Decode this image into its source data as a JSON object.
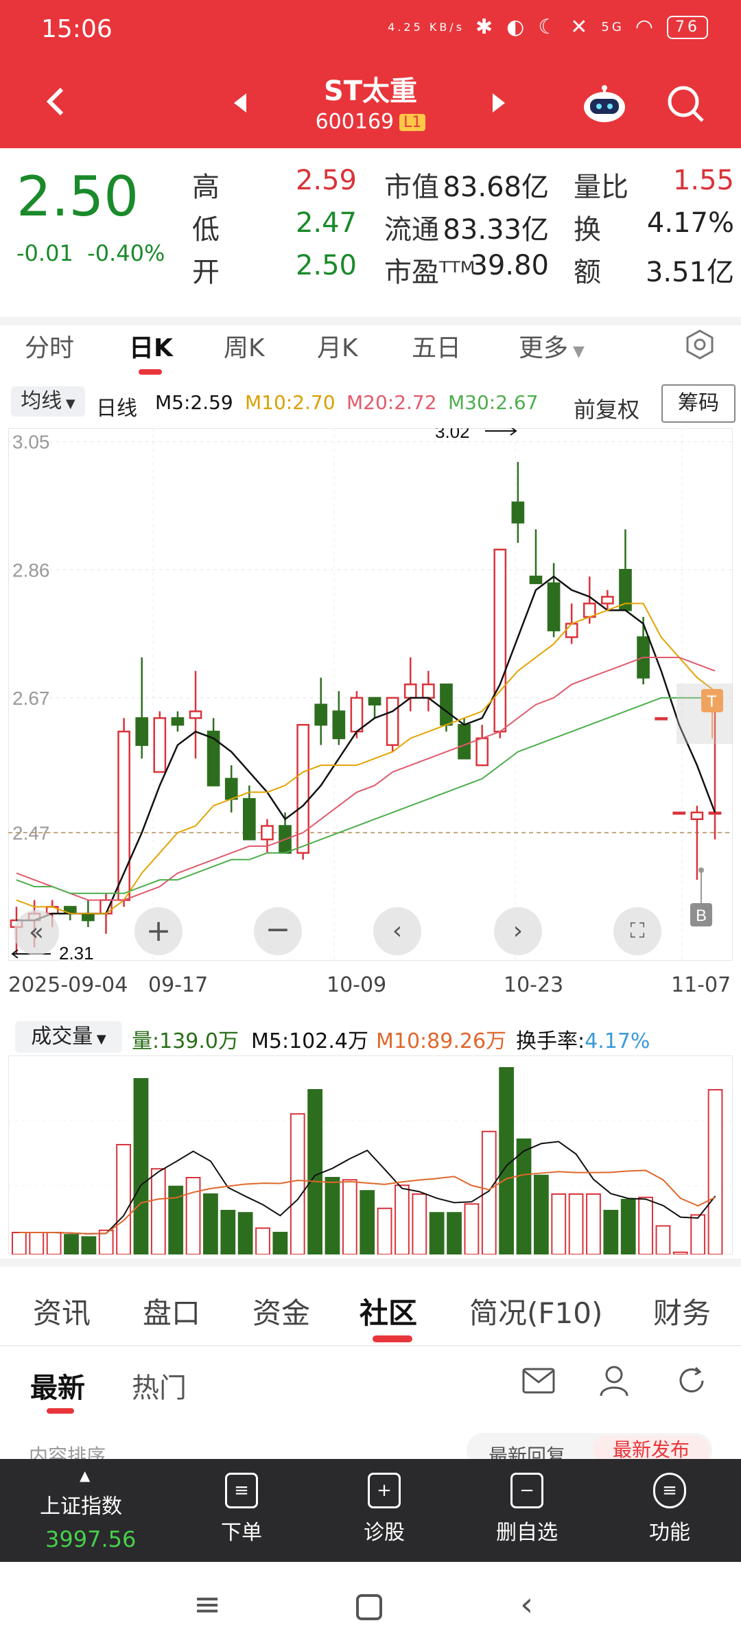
{
  "status_bar": {
    "time": "15:06",
    "net_speed": "4.25 KB/s",
    "signal": "5G",
    "battery": "76"
  },
  "header": {
    "name": "ST太重",
    "code": "600169",
    "level_badge": "L1"
  },
  "quote": {
    "price": "2.50",
    "change": "-0.01",
    "change_pct": "-0.40%",
    "high_label": "高",
    "high": "2.59",
    "low_label": "低",
    "low": "2.47",
    "open_label": "开",
    "open": "2.50",
    "mcap_label": "市值",
    "mcap": "83.68亿",
    "float_label": "流通",
    "float": "83.33亿",
    "pe_label": "市盈ᵀᵀᴹ",
    "pe": "39.80",
    "vr_label": "量比",
    "vr": "1.55",
    "turn_label": "换",
    "turn": "4.17%",
    "amt_label": "额",
    "amt": "3.51亿"
  },
  "period_tabs": [
    "分时",
    "日K",
    "周K",
    "月K",
    "五日",
    "更多"
  ],
  "indicators": {
    "ma_dropdown": "均线",
    "period": "日线",
    "ma5": "M5:2.59",
    "ma10": "M10:2.70",
    "ma20": "M20:2.72",
    "ma30": "M30:2.67",
    "adjust": "前复权",
    "chips": "筹码"
  },
  "chart_data": {
    "type": "candlestick",
    "y_ticks": [
      "3.05",
      "2.86",
      "2.67",
      "2.47"
    ],
    "y_ticks_values": [
      3.05,
      2.86,
      2.67,
      2.47
    ],
    "ylim": [
      2.28,
      3.07
    ],
    "x_labels": [
      "2025-09-04",
      "09-17",
      "10-09",
      "10-23",
      "11-07"
    ],
    "annotations": {
      "high_marker": "3.02",
      "low_marker": "2.31",
      "sell_tag": "T",
      "buy_tag": "B",
      "ref_price": 2.47
    },
    "candles": [
      {
        "o": 2.33,
        "h": 2.36,
        "l": 2.29,
        "c": 2.34
      },
      {
        "o": 2.34,
        "h": 2.37,
        "l": 2.3,
        "c": 2.35
      },
      {
        "o": 2.35,
        "h": 2.37,
        "l": 2.33,
        "c": 2.36
      },
      {
        "o": 2.36,
        "h": 2.36,
        "l": 2.34,
        "c": 2.35
      },
      {
        "o": 2.35,
        "h": 2.37,
        "l": 2.33,
        "c": 2.34
      },
      {
        "o": 2.35,
        "h": 2.38,
        "l": 2.32,
        "c": 2.37
      },
      {
        "o": 2.37,
        "h": 2.64,
        "l": 2.36,
        "c": 2.62
      },
      {
        "o": 2.64,
        "h": 2.73,
        "l": 2.58,
        "c": 2.6
      },
      {
        "o": 2.56,
        "h": 2.65,
        "l": 2.56,
        "c": 2.64
      },
      {
        "o": 2.64,
        "h": 2.65,
        "l": 2.62,
        "c": 2.63
      },
      {
        "o": 2.64,
        "h": 2.71,
        "l": 2.58,
        "c": 2.65
      },
      {
        "o": 2.62,
        "h": 2.64,
        "l": 2.54,
        "c": 2.54
      },
      {
        "o": 2.55,
        "h": 2.57,
        "l": 2.5,
        "c": 2.52
      },
      {
        "o": 2.52,
        "h": 2.54,
        "l": 2.46,
        "c": 2.46
      },
      {
        "o": 2.46,
        "h": 2.49,
        "l": 2.44,
        "c": 2.48
      },
      {
        "o": 2.48,
        "h": 2.5,
        "l": 2.44,
        "c": 2.44
      },
      {
        "o": 2.44,
        "h": 2.63,
        "l": 2.43,
        "c": 2.63
      },
      {
        "o": 2.66,
        "h": 2.7,
        "l": 2.6,
        "c": 2.63
      },
      {
        "o": 2.65,
        "h": 2.68,
        "l": 2.6,
        "c": 2.61
      },
      {
        "o": 2.62,
        "h": 2.68,
        "l": 2.61,
        "c": 2.67
      },
      {
        "o": 2.67,
        "h": 2.67,
        "l": 2.64,
        "c": 2.66
      },
      {
        "o": 2.6,
        "h": 2.67,
        "l": 2.59,
        "c": 2.67
      },
      {
        "o": 2.67,
        "h": 2.73,
        "l": 2.65,
        "c": 2.69
      },
      {
        "o": 2.67,
        "h": 2.71,
        "l": 2.65,
        "c": 2.69
      },
      {
        "o": 2.69,
        "h": 2.69,
        "l": 2.62,
        "c": 2.63
      },
      {
        "o": 2.63,
        "h": 2.64,
        "l": 2.58,
        "c": 2.58
      },
      {
        "o": 2.57,
        "h": 2.63,
        "l": 2.57,
        "c": 2.61
      },
      {
        "o": 2.62,
        "h": 2.89,
        "l": 2.61,
        "c": 2.89
      },
      {
        "o": 2.96,
        "h": 3.02,
        "l": 2.9,
        "c": 2.93
      },
      {
        "o": 2.85,
        "h": 2.92,
        "l": 2.84,
        "c": 2.84
      },
      {
        "o": 2.84,
        "h": 2.87,
        "l": 2.76,
        "c": 2.77
      },
      {
        "o": 2.76,
        "h": 2.81,
        "l": 2.75,
        "c": 2.78
      },
      {
        "o": 2.79,
        "h": 2.85,
        "l": 2.78,
        "c": 2.81
      },
      {
        "o": 2.81,
        "h": 2.83,
        "l": 2.8,
        "c": 2.82
      },
      {
        "o": 2.86,
        "h": 2.92,
        "l": 2.8,
        "c": 2.8
      },
      {
        "o": 2.76,
        "h": 2.79,
        "l": 2.69,
        "c": 2.7
      },
      {
        "o": 2.64,
        "h": 2.64,
        "l": 2.64,
        "c": 2.64
      },
      {
        "o": 2.5,
        "h": 2.5,
        "l": 2.5,
        "c": 2.5
      },
      {
        "o": 2.49,
        "h": 2.51,
        "l": 2.4,
        "c": 2.5
      },
      {
        "o": 2.5,
        "h": 2.65,
        "l": 2.46,
        "c": 2.5
      }
    ],
    "series": [
      {
        "name": "M5",
        "color": "#111111",
        "values": [
          2.34,
          2.34,
          2.35,
          2.35,
          2.35,
          2.35,
          2.41,
          2.47,
          2.54,
          2.6,
          2.62,
          2.61,
          2.59,
          2.56,
          2.53,
          2.49,
          2.51,
          2.54,
          2.58,
          2.62,
          2.64,
          2.65,
          2.67,
          2.67,
          2.65,
          2.63,
          2.64,
          2.69,
          2.76,
          2.83,
          2.85,
          2.83,
          2.82,
          2.8,
          2.8,
          2.78,
          2.71,
          2.63,
          2.57,
          2.5
        ]
      },
      {
        "name": "M10",
        "color": "#e3a300",
        "values": [
          2.37,
          2.36,
          2.36,
          2.35,
          2.35,
          2.35,
          2.37,
          2.41,
          2.44,
          2.47,
          2.48,
          2.51,
          2.52,
          2.53,
          2.53,
          2.54,
          2.56,
          2.57,
          2.57,
          2.57,
          2.58,
          2.59,
          2.61,
          2.62,
          2.63,
          2.64,
          2.65,
          2.68,
          2.71,
          2.73,
          2.75,
          2.78,
          2.79,
          2.8,
          2.81,
          2.81,
          2.76,
          2.73,
          2.7,
          2.68
        ]
      },
      {
        "name": "M20",
        "color": "#e05a6b",
        "values": [
          2.41,
          2.4,
          2.39,
          2.38,
          2.37,
          2.37,
          2.37,
          2.38,
          2.39,
          2.41,
          2.42,
          2.43,
          2.44,
          2.45,
          2.45,
          2.46,
          2.47,
          2.49,
          2.51,
          2.53,
          2.54,
          2.56,
          2.57,
          2.58,
          2.59,
          2.6,
          2.61,
          2.62,
          2.64,
          2.66,
          2.67,
          2.69,
          2.7,
          2.71,
          2.72,
          2.73,
          2.73,
          2.73,
          2.72,
          2.71
        ]
      },
      {
        "name": "M30",
        "color": "#4cae4c",
        "values": [
          2.4,
          2.39,
          2.39,
          2.38,
          2.38,
          2.38,
          2.38,
          2.39,
          2.4,
          2.4,
          2.41,
          2.42,
          2.43,
          2.43,
          2.44,
          2.44,
          2.45,
          2.46,
          2.47,
          2.48,
          2.49,
          2.5,
          2.51,
          2.52,
          2.53,
          2.54,
          2.55,
          2.57,
          2.59,
          2.6,
          2.61,
          2.62,
          2.63,
          2.64,
          2.65,
          2.66,
          2.67,
          2.67,
          2.67,
          2.67
        ]
      }
    ]
  },
  "volume": {
    "dropdown": "成交量",
    "vol": "量:139.0万",
    "m5": "M5:102.4万",
    "m10": "M10:89.26万",
    "turn_label": "换手率:",
    "turn_val": "4.17%",
    "bars": [
      20,
      20,
      20,
      18,
      16,
      22,
      100,
      160,
      78,
      62,
      70,
      55,
      40,
      38,
      24,
      20,
      128,
      150,
      70,
      68,
      58,
      42,
      63,
      55,
      38,
      38,
      46,
      112,
      170,
      105,
      72,
      55,
      55,
      55,
      40,
      50,
      52,
      26,
      2,
      36,
      150
    ]
  },
  "bottom_tabs": [
    "资讯",
    "盘口",
    "资金",
    "社区",
    "简况(F10)",
    "财务"
  ],
  "sub_tabs": [
    "最新",
    "热门"
  ],
  "sort": {
    "label": "内容排序",
    "reply": "最新回复",
    "new": "最新发布"
  },
  "toolbar": {
    "index_name": "上证指数",
    "index_val": "3997.56",
    "order": "下单",
    "diagnose": "诊股",
    "remove": "删自选",
    "func": "功能"
  }
}
